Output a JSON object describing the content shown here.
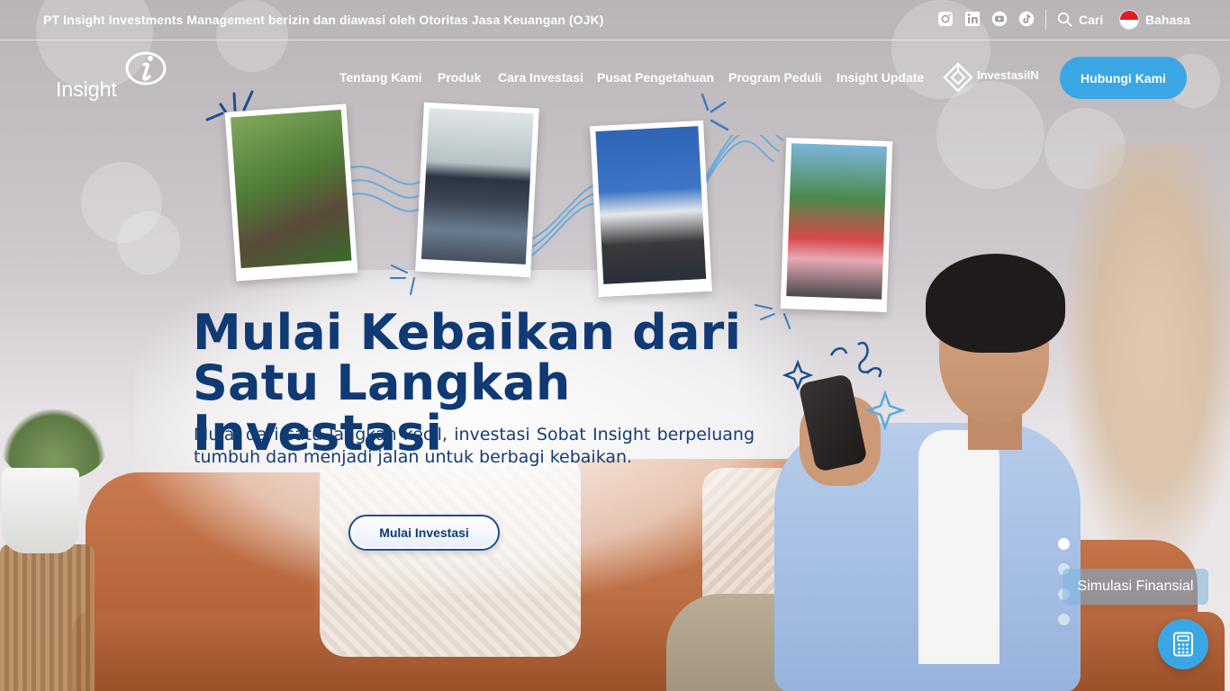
{
  "topbar": {
    "ojk_notice": "PT Insight Investments Management berizin dan diawasi oleh Otoritas Jasa Keuangan (OJK)",
    "social_icons": [
      "instagram-icon",
      "linkedin-icon",
      "youtube-icon",
      "tiktok-icon"
    ],
    "search_label": "Cari",
    "language_label": "Bahasa"
  },
  "nav": {
    "logo_text": "Insight",
    "items": [
      "Tentang Kami",
      "Produk",
      "Cara Investasi",
      "Pusat Pengetahuan",
      "Program Peduli",
      "Insight Update"
    ],
    "investasiin_label": "InvestasiIN",
    "contact_button": "Hubungi Kami"
  },
  "hero": {
    "title_line1": "Mulai Kebaikan dari",
    "title_line2": "Satu Langkah Investasi",
    "subtitle": "Mulai dari satu langkah kecil, investasi Sobat Insight berpeluang tumbuh dan menjadi jalan untuk berbagi kebaikan.",
    "cta_button": "Mulai Investasi"
  },
  "floating": {
    "simulation_label": "Simulasi Finansial",
    "calculator_icon": "calculator-icon"
  },
  "carousel": {
    "slide_count": 4,
    "active_slide": 1
  },
  "colors": {
    "accent": "#3aa7e4",
    "title_navy": "#0f3a73"
  }
}
